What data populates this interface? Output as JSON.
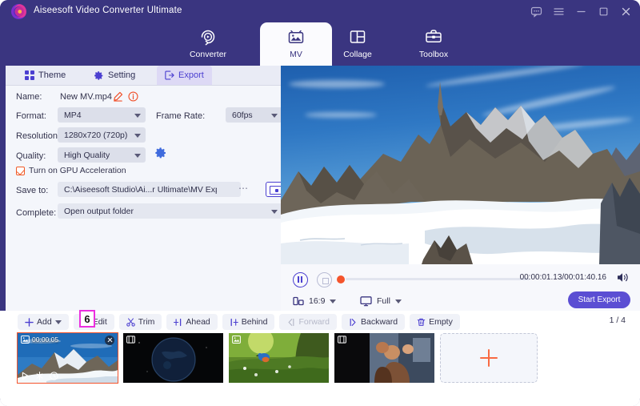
{
  "titlebar": {
    "app_title": "Aiseesoft Video Converter Ultimate",
    "buttons": [
      {
        "name": "feedback-icon",
        "label": "Feedback"
      },
      {
        "name": "menu-icon",
        "label": "Menu"
      },
      {
        "name": "minimize-icon",
        "label": "Minimize"
      },
      {
        "name": "maximize-icon",
        "label": "Maximize"
      },
      {
        "name": "close-icon",
        "label": "Close"
      }
    ]
  },
  "nav": {
    "items": [
      {
        "label": "Converter",
        "icon": "converter-icon",
        "active": false
      },
      {
        "label": "MV",
        "icon": "mv-icon",
        "active": true
      },
      {
        "label": "Collage",
        "icon": "collage-icon",
        "active": false
      },
      {
        "label": "Toolbox",
        "icon": "toolbox-icon",
        "active": false
      }
    ]
  },
  "panel": {
    "tabs": [
      {
        "label": "Theme",
        "icon": "grid-icon",
        "active": false
      },
      {
        "label": "Setting",
        "icon": "gear-icon",
        "active": false
      },
      {
        "label": "Export",
        "icon": "export-icon",
        "active": true
      }
    ],
    "form": {
      "name_label": "Name:",
      "name_value": "New MV.mp4",
      "format_label": "Format:",
      "format_value": "MP4",
      "framerate_label": "Frame Rate:",
      "framerate_value": "60fps",
      "resolution_label": "Resolution:",
      "resolution_value": "1280x720 (720p)",
      "quality_label": "Quality:",
      "quality_value": "High Quality",
      "gpu_label": "Turn on GPU Acceleration",
      "saveto_label": "Save to:",
      "saveto_value": "C:\\Aiseesoft Studio\\Ai...r Ultimate\\MV Exported",
      "complete_label": "Complete:",
      "complete_value": "Open output folder"
    },
    "start_export_label": "Start Export",
    "annotation_number": "6"
  },
  "preview": {
    "timecode": "00:00:01.13/00:01:40.16",
    "aspect_ratio": "16:9",
    "screen_mode": "Full",
    "start_export_label": "Start Export"
  },
  "toolbar": {
    "buttons": [
      {
        "label": "Add",
        "icon": "plus-icon",
        "dropdown": true,
        "disabled": false
      },
      {
        "label": "Edit",
        "icon": "edit-icon",
        "dropdown": false,
        "disabled": false
      },
      {
        "label": "Trim",
        "icon": "scissors-icon",
        "dropdown": false,
        "disabled": false
      },
      {
        "label": "Ahead",
        "icon": "ahead-icon",
        "dropdown": false,
        "disabled": false
      },
      {
        "label": "Behind",
        "icon": "behind-icon",
        "dropdown": false,
        "disabled": false
      },
      {
        "label": "Forward",
        "icon": "forward-icon",
        "dropdown": false,
        "disabled": true
      },
      {
        "label": "Backward",
        "icon": "backward-icon",
        "dropdown": false,
        "disabled": false
      },
      {
        "label": "Empty",
        "icon": "trash-icon",
        "dropdown": false,
        "disabled": false
      }
    ],
    "page_count": "1 / 4"
  },
  "thumbnails": [
    {
      "duration": "00:00:05",
      "selected": true,
      "scene": "snow-mountain"
    },
    {
      "duration": "",
      "selected": false,
      "scene": "earth-space"
    },
    {
      "duration": "",
      "selected": false,
      "scene": "bird-meadow"
    },
    {
      "duration": "",
      "selected": false,
      "scene": "person-portrait"
    }
  ],
  "colors": {
    "header": "#3a3580",
    "accent": "#5b4ed3",
    "annotation": "#ec2fe0",
    "selection": "#f4542c",
    "panel_bg": "#f4f6fb"
  }
}
